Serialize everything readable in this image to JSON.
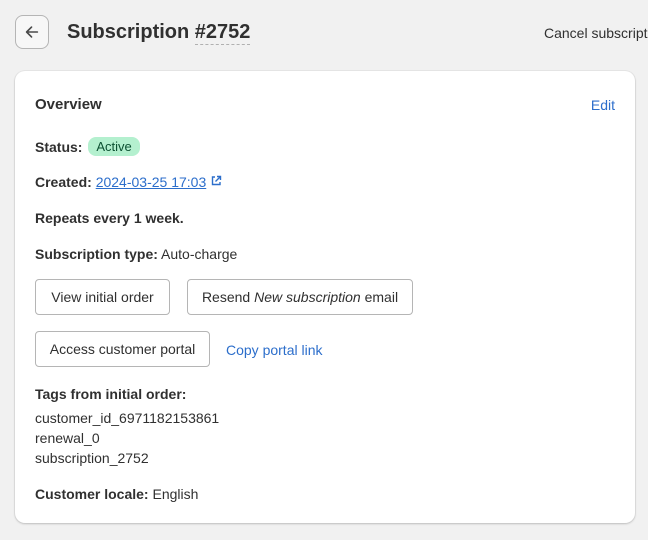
{
  "header": {
    "title_prefix": "Subscription",
    "title_number": "#2752",
    "cancel_label": "Cancel subscription"
  },
  "overview": {
    "title": "Overview",
    "edit_label": "Edit",
    "status_label": "Status:",
    "status_value": "Active",
    "created_label": "Created:",
    "created_value": "2024-03-25 17:03",
    "repeats_text": "Repeats every 1 week.",
    "type_label": "Subscription type:",
    "type_value": "Auto-charge",
    "view_order_label": "View initial order",
    "resend_prefix": "Resend",
    "resend_italic": "New subscription",
    "resend_suffix": "email",
    "portal_label": "Access customer portal",
    "copy_portal_label": "Copy portal link",
    "tags_label": "Tags from initial order:",
    "tags": [
      "customer_id_6971182153861",
      "renewal_0",
      "subscription_2752"
    ],
    "locale_label": "Customer locale:",
    "locale_value": "English"
  },
  "colors": {
    "background": "#f1f1f1",
    "card": "#ffffff",
    "link": "#2c6ecb",
    "badge_bg": "#b4f0cf",
    "badge_text": "#0c5132"
  },
  "icons": {
    "back": "arrow-left-icon",
    "external": "external-link-icon"
  }
}
